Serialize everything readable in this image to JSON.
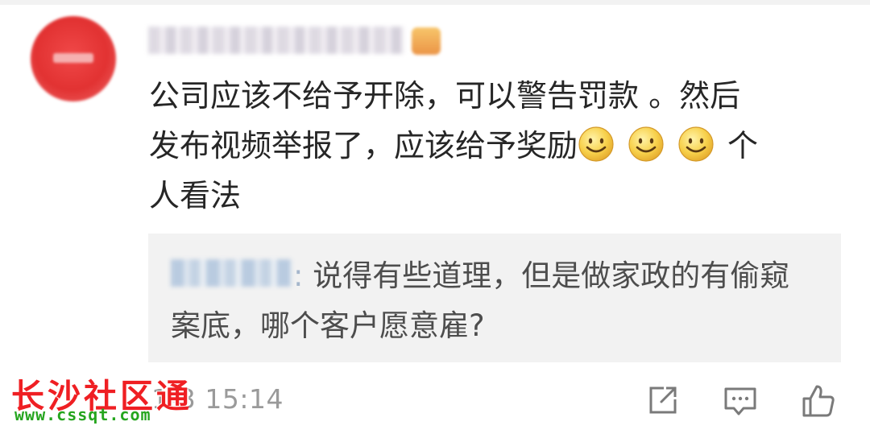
{
  "post": {
    "comment_lines": [
      "公司应该不给予开除，可以警告罚款 。然后",
      "发布视频举报了，应该给予奖励",
      "个",
      "人看法"
    ],
    "emoji_name": "smile-emoji",
    "emoji_count": 3
  },
  "reply": {
    "colon": ":",
    "text": "说得有些道理，但是做家政的有偷窥案底，哪个客户愿意雇?"
  },
  "footer": {
    "timestamp": "1-3 15:14",
    "actions": {
      "share_icon": "share-icon",
      "comment_icon": "comment-icon",
      "like_icon": "thumbs-up-icon"
    }
  },
  "watermark": {
    "title": "长沙社区通",
    "url": "www.cssqt.com"
  },
  "colors": {
    "comment_text": "#262626",
    "reply_text": "#4d4d4d",
    "reply_bg": "#f2f2f2",
    "timestamp": "#9a9a9a",
    "watermark_red": "#ef1f23",
    "watermark_green": "#25a51e"
  }
}
